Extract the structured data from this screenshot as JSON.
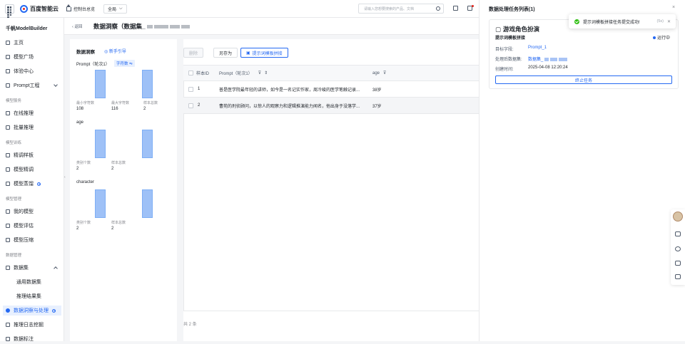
{
  "topbar": {
    "logo": "百度智能云",
    "console": "控制台总览",
    "region": "全局",
    "search_placeholder": "请输入您想要搜索的产品、文档"
  },
  "sidebar": {
    "title": "千帆ModelBuilder",
    "items": [
      {
        "label": "主页"
      },
      {
        "label": "模型广场"
      },
      {
        "label": "体验中心"
      },
      {
        "label": "Prompt工程"
      }
    ],
    "group_service": "模型服务",
    "service_items": [
      {
        "label": "在线推理"
      },
      {
        "label": "批量推理"
      }
    ],
    "group_train": "模型训练",
    "train_items": [
      {
        "label": "精调样板"
      },
      {
        "label": "模型精调"
      },
      {
        "label": "模型蒸馏"
      }
    ],
    "group_manage": "模型管理",
    "manage_items": [
      {
        "label": "我的模型"
      },
      {
        "label": "模型评估"
      },
      {
        "label": "模型压缩"
      }
    ],
    "group_data": "数据管理",
    "data_items": [
      {
        "label": "数据集"
      },
      {
        "label": "通用数据集"
      },
      {
        "label": "推理结果集"
      },
      {
        "label": "数据洞察与处理"
      },
      {
        "label": "推理日志挖掘"
      },
      {
        "label": "数据标注"
      }
    ]
  },
  "page": {
    "back": "返回",
    "title": "数据洞察（数据集_"
  },
  "insight": {
    "title": "数据洞察",
    "guide": "新手引导",
    "fields": [
      {
        "name": "Prompt（轮次1）",
        "chip": "字符数",
        "stats": [
          {
            "label": "最小字符数",
            "value": "108"
          },
          {
            "label": "最大字符数",
            "value": "116"
          },
          {
            "label": "样本总数",
            "value": "2"
          }
        ]
      },
      {
        "name": "age",
        "stats": [
          {
            "label": "类别个数",
            "value": "2"
          },
          {
            "label": "样本总数",
            "value": "2"
          }
        ]
      },
      {
        "name": "character",
        "stats": [
          {
            "label": "类别个数",
            "value": "2"
          },
          {
            "label": "样本总数",
            "value": "2"
          }
        ]
      }
    ]
  },
  "toolbar": {
    "delete": "删除",
    "save_as": "另存为",
    "prompt_template": "提示词模板拼接"
  },
  "table": {
    "columns": [
      "样本ID",
      "Prompt（轮次1）",
      "age"
    ],
    "rows": [
      {
        "id": "1",
        "prompt": "普是医学院最年轻的讲师，如今是一名记实作家，周冷峻的医学笔触记录...",
        "age": "38岁"
      },
      {
        "id": "2",
        "prompt": "曹苑的刑侦顾问，以惊人的观察力和逻辑推演能力闻名，他出身于没落学...",
        "age": "37岁"
      }
    ],
    "total": "共 2 条"
  },
  "drawer": {
    "title": "数据处理任务列表(1)",
    "card": {
      "title": "游戏角色扮演",
      "subtitle": "提示词模板拼接",
      "status": "运行中",
      "target_label": "目标字段:",
      "target_value": "Prompt_1",
      "dataset_label": "处理后数据集:",
      "dataset_value": "数据集_",
      "created_label": "创建时间:",
      "created_value": "2025-04-08 12:20:24",
      "stop": "终止任务"
    }
  },
  "toast": {
    "message": "提示词模板拼接任务提交成功!",
    "countdown": "(5s)"
  },
  "colors": {
    "accent": "#2468f2",
    "success": "#30bf13",
    "bar": "#9ec1f7"
  }
}
